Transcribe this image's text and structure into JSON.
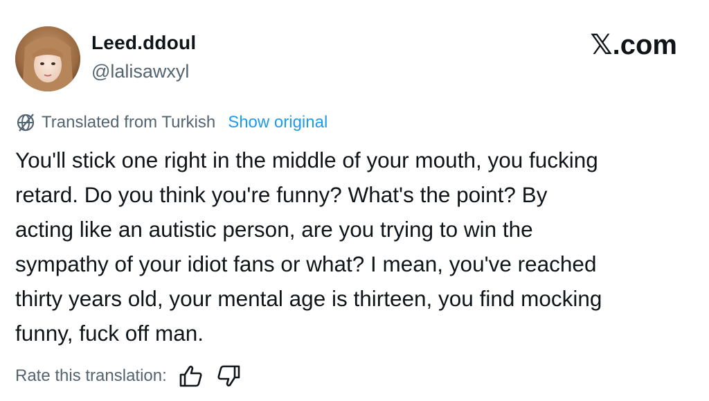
{
  "user": {
    "display_name": "Leed.ddoul",
    "handle": "@lalisawxyl",
    "avatar_icon": "profile-photo"
  },
  "brand": {
    "label": "𝕏.com"
  },
  "translation": {
    "icon": "translate-globe-icon",
    "note": "Translated from Turkish",
    "show_original": "Show original"
  },
  "tweet": {
    "text": "You'll stick one right in the middle of your mouth, you fucking\nretard. Do you think you're funny? What's the point? By\nacting like an autistic person, are you trying to win the\nsympathy of your idiot fans or what? I mean, you've reached\nthirty years old, your mental age is thirteen, you find mocking\nfunny, fuck off man."
  },
  "rating": {
    "label": "Rate this translation:",
    "up_icon": "thumbs-up-icon",
    "down_icon": "thumbs-down-icon"
  },
  "colors": {
    "text": "#0f1419",
    "secondary": "#536471",
    "link": "#1d9bf0"
  }
}
